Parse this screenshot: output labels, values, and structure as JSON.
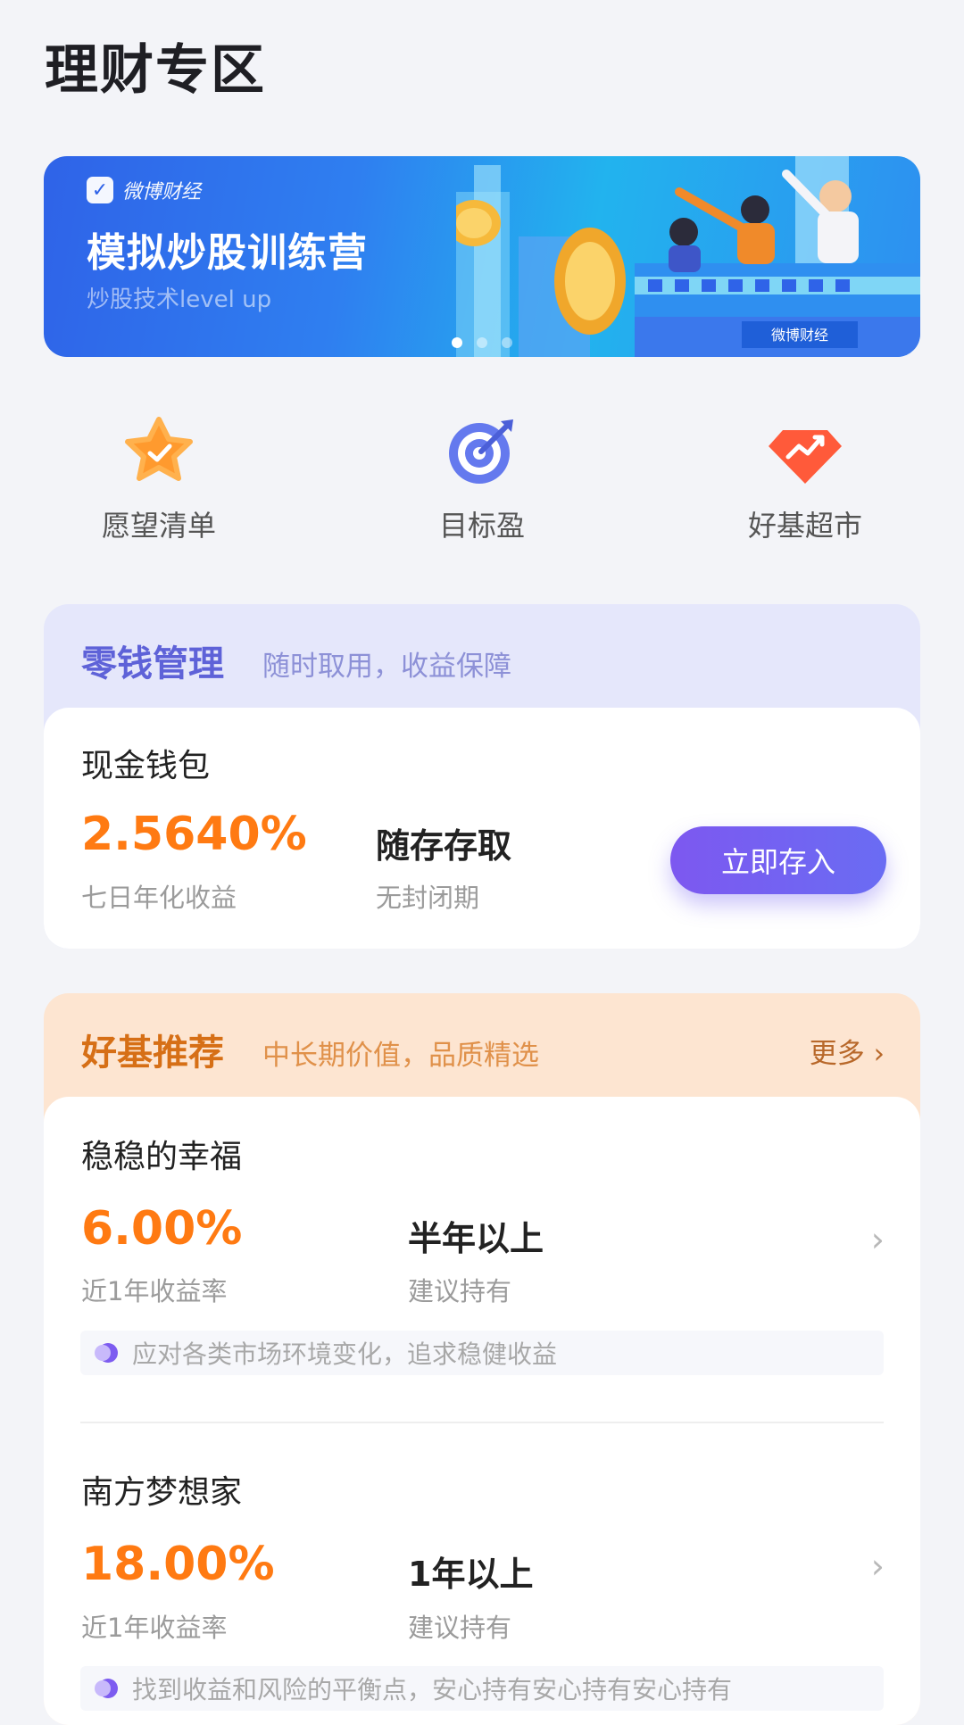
{
  "page": {
    "title": "理财专区"
  },
  "banner": {
    "brand": "微博财经",
    "title": "模拟炒股训练营",
    "subtitle": "炒股技术level up",
    "sign_text": "微博财经",
    "dots": 3,
    "active_dot": 1
  },
  "quick_links": [
    {
      "label": "愿望清单",
      "icon": "star-check-icon",
      "color": "#ff9a2e"
    },
    {
      "label": "目标盈",
      "icon": "target-icon",
      "color": "#5b6ee8"
    },
    {
      "label": "好基超市",
      "icon": "diamond-trend-icon",
      "color": "#ff5a3a"
    }
  ],
  "change_mgmt": {
    "title": "零钱管理",
    "subtitle": "随时取用，收益保障",
    "product": {
      "name": "现金钱包",
      "rate": "2.5640%",
      "rate_label": "七日年化收益",
      "feature": "随存存取",
      "feature_label": "无封闭期",
      "button": "立即存入"
    }
  },
  "fund_recommend": {
    "title": "好基推荐",
    "subtitle": "中长期价值，品质精选",
    "more": "更多",
    "funds": [
      {
        "name": "稳稳的幸福",
        "rate": "6.00%",
        "rate_label": "近1年收益率",
        "hold": "半年以上",
        "hold_label": "建议持有",
        "desc": "应对各类市场环境变化，追求稳健收益"
      },
      {
        "name": "南方梦想家",
        "rate": "18.00%",
        "rate_label": "近1年收益率",
        "hold": "1年以上",
        "hold_label": "建议持有",
        "desc": "找到收益和风险的平衡点，安心持有安心持有安心持有"
      }
    ]
  },
  "colors": {
    "accent_orange": "#ff7a12",
    "accent_purple": "#6a6cf3",
    "banner_blue": "#2f7ff0"
  }
}
